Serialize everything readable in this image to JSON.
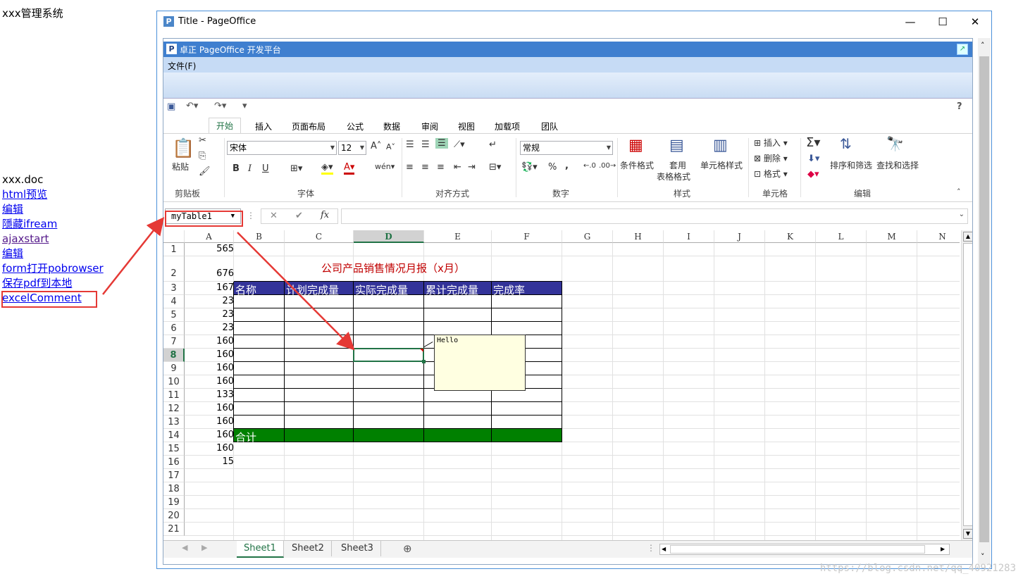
{
  "page": {
    "system_title": "xxx管理系统",
    "side_links": [
      {
        "label": "xxx.doc",
        "kind": "plain"
      },
      {
        "label": "html预览",
        "kind": "link"
      },
      {
        "label": "编辑",
        "kind": "link"
      },
      {
        "label": "隱藏ifream",
        "kind": "link"
      },
      {
        "label": "ajaxstart",
        "kind": "visited"
      },
      {
        "label": "编辑",
        "kind": "link"
      },
      {
        "label": "form打开pobrowser",
        "kind": "link"
      },
      {
        "label": "保存pdf到本地",
        "kind": "link"
      },
      {
        "label": "excelComment",
        "kind": "link"
      }
    ],
    "watermark": "https://blog.csdn.net/qq_40921283"
  },
  "window": {
    "title": "Title - PageOffice",
    "app_icon": "P",
    "minimize_glyph": "—",
    "maximize_glyph": "☐",
    "close_glyph": "✕"
  },
  "pageoffice": {
    "bar_icon": "P",
    "bar_title": "卓正 PageOffice 开发平台",
    "menu_file": "文件(F)"
  },
  "excel": {
    "help": "?",
    "tabs": [
      "开始",
      "插入",
      "页面布局",
      "公式",
      "数据",
      "审阅",
      "视图",
      "加载项",
      "团队"
    ],
    "active_tab": "开始",
    "ribbon": {
      "clipboard": {
        "paste": "粘贴",
        "group": "剪贴板"
      },
      "font": {
        "name": "宋体",
        "size": "12",
        "bold": "B",
        "italic": "I",
        "underline": "U",
        "group": "字体"
      },
      "align": {
        "group": "对齐方式"
      },
      "number": {
        "format": "常规",
        "percent": "%",
        "comma": ",",
        "group": "数字"
      },
      "styles": {
        "cond": "条件格式",
        "table1": "套用",
        "table2": "表格格式",
        "cell": "单元格样式",
        "group": "样式"
      },
      "cells": {
        "insert": "插入",
        "delete": "删除",
        "format": "格式",
        "group": "单元格"
      },
      "edit": {
        "sort": "排序和筛选",
        "find": "查找和选择",
        "group": "编辑"
      }
    },
    "name_box": "myTable1",
    "formula_cancel": "✕",
    "formula_enter": "✔",
    "formula_fx": "fx",
    "columns": [
      "A",
      "B",
      "C",
      "D",
      "E",
      "F",
      "G",
      "H",
      "I",
      "J",
      "K",
      "L",
      "M",
      "N"
    ],
    "selected_column": "D",
    "rows": [
      "1",
      "2",
      "3",
      "4",
      "5",
      "6",
      "7",
      "8",
      "9",
      "10",
      "11",
      "12",
      "13",
      "14",
      "15",
      "16",
      "17",
      "18",
      "19",
      "20",
      "21"
    ],
    "selected_row": "8",
    "col_a_values": [
      "565",
      "676",
      "167",
      "23",
      "23",
      "23",
      "160",
      "160",
      "160",
      "160",
      "133",
      "160",
      "160",
      "160",
      "160",
      "15"
    ],
    "report_title": "公司产品销售情况月报（x月）",
    "table_headers": [
      "名称",
      "计划完成量",
      "实际完成量",
      "累计完成量",
      "完成率"
    ],
    "total_label": "合计",
    "header_color": "#333399",
    "total_color": "#008000",
    "comment_text": "Hello",
    "sheets": [
      "Sheet1",
      "Sheet2",
      "Sheet3"
    ],
    "active_sheet": "Sheet1"
  }
}
